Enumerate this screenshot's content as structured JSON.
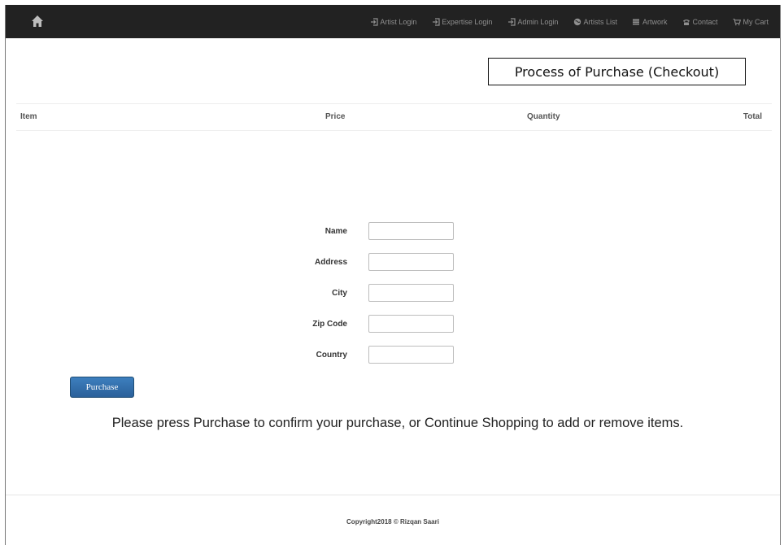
{
  "navbar": {
    "home_icon": "home-icon",
    "items": [
      {
        "label": "Artist Login",
        "icon": "login-icon"
      },
      {
        "label": "Expertise Login",
        "icon": "login-icon"
      },
      {
        "label": "Admin Login",
        "icon": "login-icon"
      },
      {
        "label": "Artists List",
        "icon": "globe-icon"
      },
      {
        "label": "Artwork",
        "icon": "artwork-icon"
      },
      {
        "label": "Contact",
        "icon": "phone-icon"
      },
      {
        "label": "My Cart",
        "icon": "cart-icon"
      }
    ],
    "background_color": "#222222",
    "text_color": "#8f8f8f"
  },
  "page": {
    "title": "Process of Purchase (Checkout)"
  },
  "cart_table": {
    "columns": [
      "Item",
      "Price",
      "Quantity",
      "Total"
    ],
    "rows": []
  },
  "form": {
    "fields": [
      {
        "label": "Name",
        "value": ""
      },
      {
        "label": "Address",
        "value": ""
      },
      {
        "label": "City",
        "value": ""
      },
      {
        "label": "Zip Code",
        "value": ""
      },
      {
        "label": "Country",
        "value": ""
      }
    ],
    "submit_label": "Purchase",
    "button_color": "#2a609a"
  },
  "instruction": "Please press Purchase to confirm your purchase, or Continue Shopping to add or remove items.",
  "footer": {
    "copyright": "Copyright2018 © Rizqan Saari"
  }
}
